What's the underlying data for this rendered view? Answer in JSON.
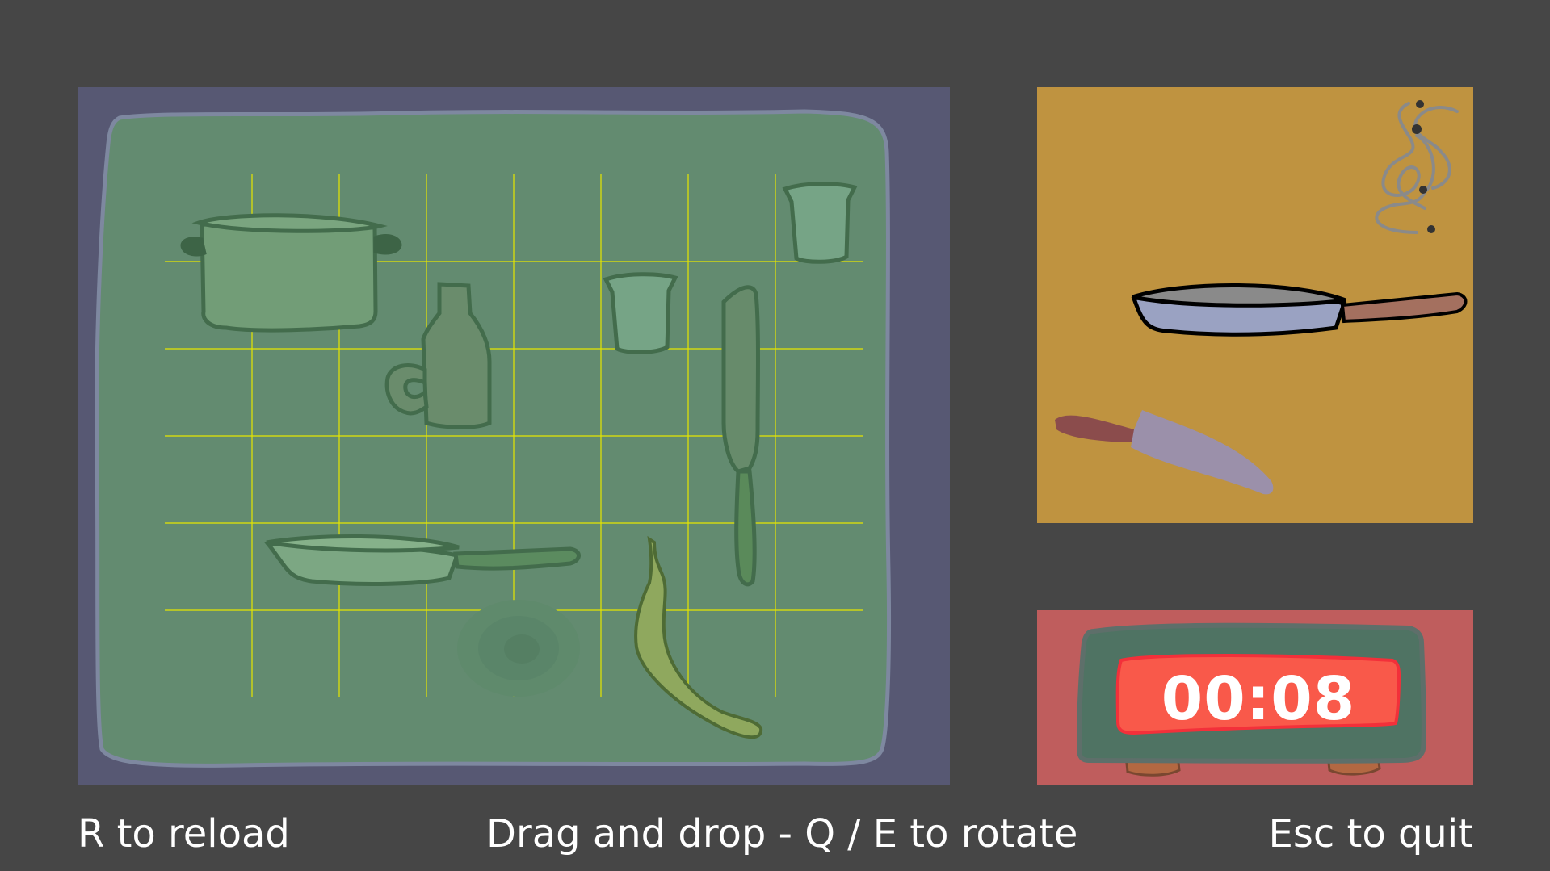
{
  "game": {
    "board": {
      "columns": 8,
      "rows": 6,
      "pieces": [
        {
          "name": "pot",
          "label": "pot"
        },
        {
          "name": "mug",
          "label": "mug"
        },
        {
          "name": "cup",
          "label": "cup"
        },
        {
          "name": "cup",
          "label": "cup"
        },
        {
          "name": "knife",
          "label": "knife"
        },
        {
          "name": "frying-pan",
          "label": "frying pan"
        },
        {
          "name": "banana",
          "label": "banana"
        },
        {
          "name": "lid-shadow",
          "label": "shadow"
        }
      ]
    },
    "preview": {
      "items": [
        "frying-pan",
        "knife",
        "steam"
      ]
    },
    "timer": {
      "display": "00:08"
    },
    "hints": {
      "reload": "R to reload",
      "drag": "Drag and drop - Q / E to rotate",
      "quit": "Esc to quit"
    },
    "colors": {
      "background": "#464646",
      "board_frame": "#575873",
      "board_mat": "#638b70",
      "grid_line": "#e6e600",
      "preview_bg": "#bf9340",
      "timer_bg": "#bf5d5d",
      "timer_body": "#4f7363",
      "timer_display": "#f9594a"
    }
  }
}
